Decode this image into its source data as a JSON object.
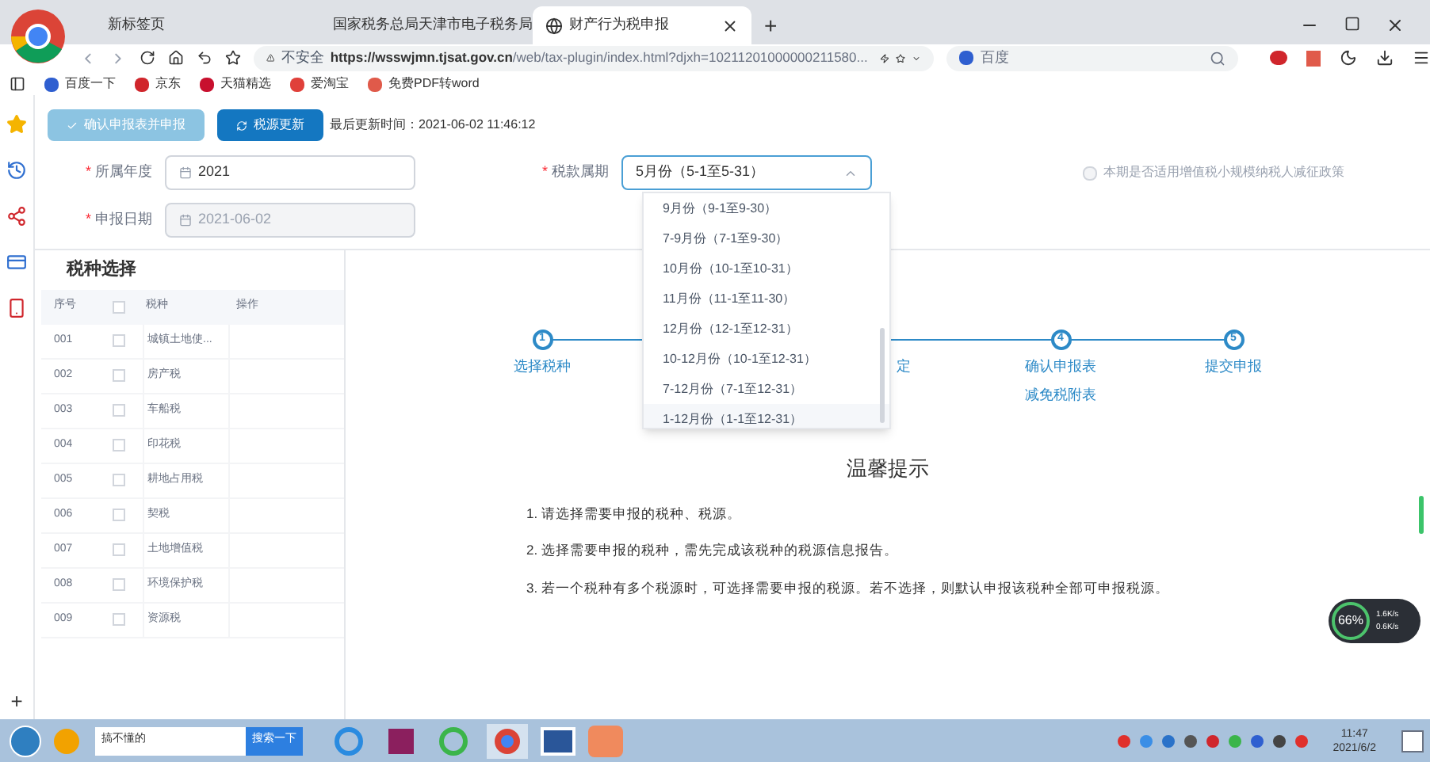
{
  "browser": {
    "tabs": [
      {
        "title": "新标签页",
        "selected": false
      },
      {
        "title": "国家税务总局天津市电子税务局",
        "selected": false
      },
      {
        "title": "财产行为税申报",
        "selected": true
      }
    ],
    "address": {
      "security": "不安全",
      "url_host": "https://wsswjmn.tjsat.gov.cn",
      "url_path": "/web/tax-plugin/index.html?djxh=10211201000000211580..."
    },
    "search": {
      "placeholder": "百度"
    },
    "bookmarks": [
      {
        "label": "百度一下",
        "color": "#2f5fd0"
      },
      {
        "label": "京东",
        "color": "#d0262c"
      },
      {
        "label": "天猫精选",
        "color": "#c8102e"
      },
      {
        "label": "爱淘宝",
        "color": "#e0403a"
      },
      {
        "label": "免费PDF转word",
        "color": "#e05a4a"
      }
    ],
    "new_tab_label": "+"
  },
  "page": {
    "buttons": [
      {
        "label": "确认申报表并申报",
        "disabled": true
      },
      {
        "label": "税源更新",
        "disabled": false
      }
    ],
    "last_update": "最后更新时间：2021-06-02 11:46:12",
    "fields": [
      {
        "required_mark": "*",
        "label": "所属年度",
        "value": "2021",
        "disabled": false
      },
      {
        "required_mark": "*",
        "label": "申报日期",
        "value": "2021-06-02",
        "disabled": true
      }
    ],
    "period": {
      "required_mark": "*",
      "label": "税款属期",
      "value": "5月份（5-1至5-31）",
      "expanded": true,
      "options": [
        {
          "label": "9月份（9-1至9-30）",
          "highlighted": false
        },
        {
          "label": "7-9月份（7-1至9-30）",
          "highlighted": false
        },
        {
          "label": "10月份（10-1至10-31）",
          "highlighted": false
        },
        {
          "label": "11月份（11-1至11-30）",
          "highlighted": false
        },
        {
          "label": "12月份（12-1至12-31）",
          "highlighted": false
        },
        {
          "label": "10-12月份（10-1至12-31）",
          "highlighted": false
        },
        {
          "label": "7-12月份（7-1至12-31）",
          "highlighted": false
        },
        {
          "label": "1-12月份（1-1至12-31）",
          "highlighted": true
        }
      ]
    },
    "policy": {
      "label": "本期是否适用增值税小规模纳税人减征政策",
      "checked": false,
      "disabled": true
    },
    "tax_panel": {
      "title": "税种选择",
      "columns": [
        "序号",
        "税种",
        "操作"
      ],
      "all_checked": false,
      "rows": [
        {
          "index": "001",
          "name": "城镇土地使...",
          "checked": false
        },
        {
          "index": "002",
          "name": "房产税",
          "checked": false
        },
        {
          "index": "003",
          "name": "车船税",
          "checked": false
        },
        {
          "index": "004",
          "name": "印花税",
          "checked": false
        },
        {
          "index": "005",
          "name": "耕地占用税",
          "checked": false
        },
        {
          "index": "006",
          "name": "契税",
          "checked": false
        },
        {
          "index": "007",
          "name": "土地增值税",
          "checked": false
        },
        {
          "index": "008",
          "name": "环境保护税",
          "checked": false
        },
        {
          "index": "009",
          "name": "资源税",
          "checked": false
        }
      ]
    },
    "steps": [
      {
        "number": "1",
        "labels": [
          "选择税种"
        ]
      },
      {
        "kind": "hidden"
      },
      {
        "kind": "partial",
        "labels": [
          "定"
        ]
      },
      {
        "number": "4",
        "labels": [
          "确认申报表",
          "减免税附表"
        ]
      },
      {
        "number": "5",
        "labels": [
          "提交申报"
        ]
      }
    ],
    "tips": {
      "title": "温馨提示",
      "items": [
        "1. 请选择需要申报的税种、税源。",
        "2. 选择需要申报的税种，需先完成该税种的税源信息报告。",
        "3. 若一个税种有多个税源时，可选择需要申报的税源。若不选择，则默认申报该税种全部可申报税源。"
      ]
    },
    "net_widget": {
      "percent": "66%",
      "up": "1.6K/s",
      "down": "0.6K/s"
    }
  },
  "sidebar_add": "+",
  "taskbar": {
    "search_value": "搞不懂的",
    "search_button": "搜索一下",
    "time": "11:47",
    "date": "2021/6/2"
  }
}
